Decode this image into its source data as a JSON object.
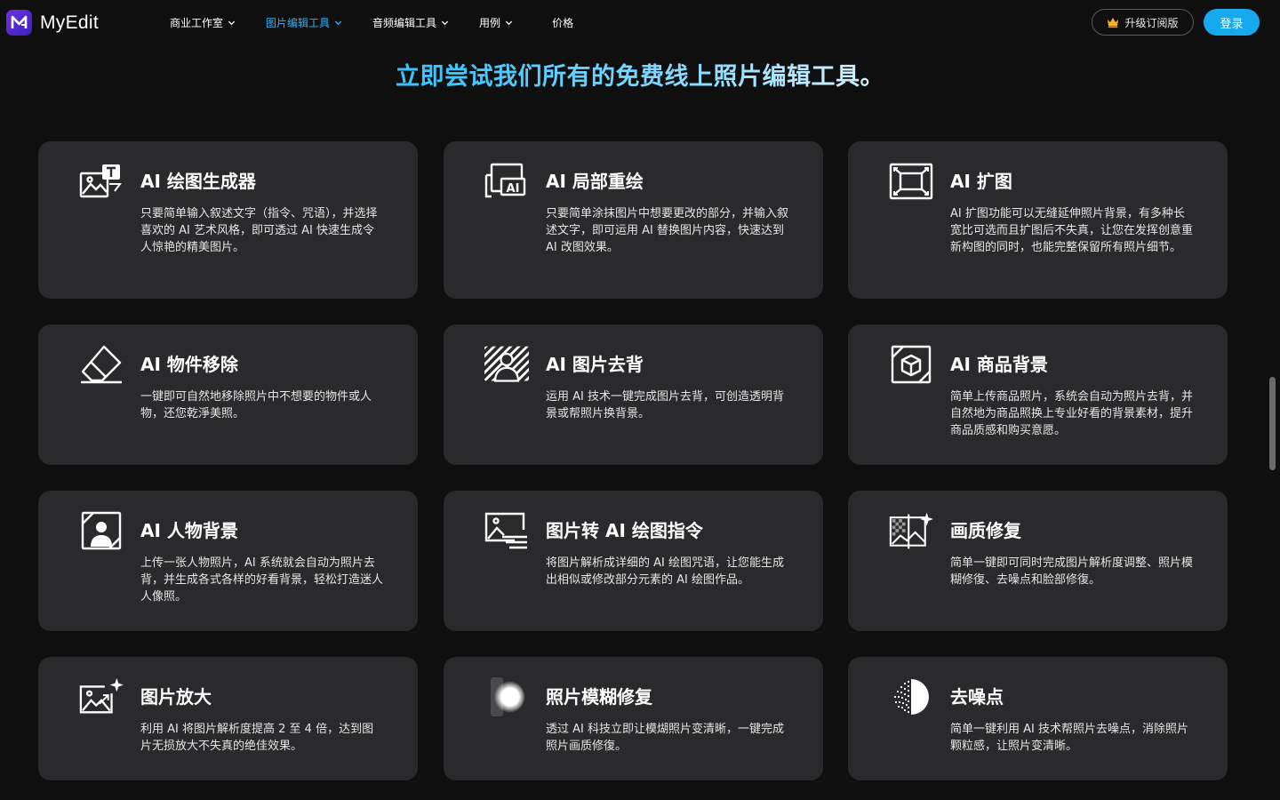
{
  "header": {
    "logo_text": "MyEdit",
    "nav": [
      {
        "label": "商业工作室",
        "has_chevron": true,
        "active": false
      },
      {
        "label": "图片编辑工具",
        "has_chevron": true,
        "active": true
      },
      {
        "label": "音频编辑工具",
        "has_chevron": true,
        "active": false
      },
      {
        "label": "用例",
        "has_chevron": true,
        "active": false
      },
      {
        "label": "价格",
        "has_chevron": false,
        "active": false
      }
    ],
    "upgrade_label": "升级订阅版",
    "login_label": "登录"
  },
  "main": {
    "title": "立即尝试我们所有的免费线上照片编辑工具。",
    "cards": [
      {
        "title": "AI 绘图生成器",
        "desc": "只要简单输入叙述文字（指令、咒语），并选择喜欢的 AI 艺术风格，即可透过 AI 快速生成令人惊艳的精美图片。",
        "icon": "ai-image-generator-icon"
      },
      {
        "title": "AI 局部重绘",
        "desc": "只要简单涂抹图片中想要更改的部分，并输入叙述文字，即可运用 AI 替换图片内容，快速达到 AI 改图效果。",
        "icon": "ai-replace-icon"
      },
      {
        "title": "AI 扩图",
        "desc": "AI 扩图功能可以无缝延伸照片背景，有多种长宽比可选而且扩图后不失真，让您在发挥创意重新构图的同时，也能完整保留所有照片细节。",
        "icon": "ai-expand-icon"
      },
      {
        "title": "AI 物件移除",
        "desc": "一键即可自然地移除照片中不想要的物件或人物，还您乾淨美照。",
        "icon": "eraser-icon"
      },
      {
        "title": "AI 图片去背",
        "desc": "运用 AI 技术一键完成图片去背，可创造透明背景或帮照片换背景。",
        "icon": "background-remover-icon"
      },
      {
        "title": "AI 商品背景",
        "desc": "简单上传商品照片，系统会自动为照片去背，并自然地为商品照换上专业好看的背景素材，提升商品质感和购买意愿。",
        "icon": "product-background-icon"
      },
      {
        "title": "AI 人物背景",
        "desc": "上传一张人物照片，AI 系统就会自动为照片去背，并生成各式各样的好看背景，轻松打造迷人人像照。",
        "icon": "portrait-background-icon"
      },
      {
        "title": "图片转 AI 绘图指令",
        "desc": "将图片解析成详细的 AI 绘图咒语，让您能生成出相似或修改部分元素的 AI 绘图作品。",
        "icon": "image-to-prompt-icon"
      },
      {
        "title": "画质修复",
        "desc": "简单一键即可同时完成图片解析度调整、照片模糊修復、去噪点和脸部修復。",
        "icon": "photo-enhance-icon"
      },
      {
        "title": "图片放大",
        "desc": "利用 AI 将图片解析度提高 2 至 4 倍，达到图片无损放大不失真的绝佳效果。",
        "icon": "image-upscale-icon"
      },
      {
        "title": "照片模糊修复",
        "desc": "透过 AI 科技立即让模煳照片变清晰，一键完成照片画质修復。",
        "icon": "unblur-icon"
      },
      {
        "title": "去噪点",
        "desc": "简单一键利用 AI 技术帮照片去噪点，消除照片颗粒感，让照片变清晰。",
        "icon": "denoise-icon"
      }
    ]
  },
  "colors": {
    "accent": "#16a9ee",
    "nav_active": "#2fb0f5",
    "card_bg": "#2a2a2c",
    "page_bg": "#0f0f10"
  }
}
